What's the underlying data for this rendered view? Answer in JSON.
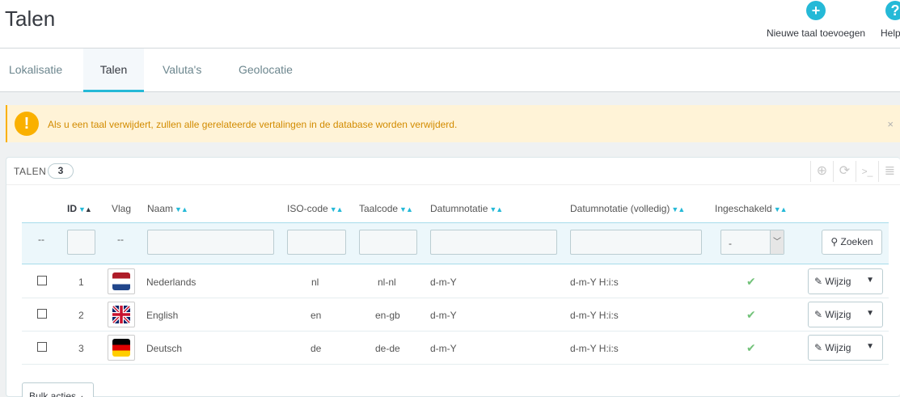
{
  "page": {
    "title": "Talen"
  },
  "toolbar": {
    "add": {
      "label": "Nieuwe taal toevoegen",
      "icon": "plus-circle-icon"
    },
    "help": {
      "label": "Help",
      "icon": "question-circle-icon"
    }
  },
  "tabs": [
    {
      "label": "Lokalisatie",
      "active": false
    },
    {
      "label": "Talen",
      "active": true
    },
    {
      "label": "Valuta's",
      "active": false
    },
    {
      "label": "Geolocatie",
      "active": false
    }
  ],
  "alert": {
    "text": "Als u een taal verwijdert, zullen alle gerelateerde vertalingen in de database worden verwijderd.",
    "close": "×",
    "icon": "exclamation-icon"
  },
  "panel": {
    "title": "TALEN",
    "count": "3",
    "tools": [
      "add-icon",
      "refresh-icon",
      "sql-terminal-icon",
      "database-icon"
    ]
  },
  "table": {
    "headers": {
      "id": "ID",
      "flag": "Vlag",
      "name": "Naam",
      "iso": "ISO-code",
      "lang": "Taalcode",
      "date": "Datumnotatie",
      "date_full": "Datumnotatie (volledig)",
      "active": "Ingeschakeld"
    },
    "filter": {
      "dash": "--",
      "select_value": "-",
      "search_label": "Zoeken"
    },
    "rows": [
      {
        "id": "1",
        "name": "Nederlands",
        "iso": "nl",
        "lang": "nl-nl",
        "date": "d-m-Y",
        "date_full": "d-m-Y H:i:s",
        "enabled": true
      },
      {
        "id": "2",
        "name": "English",
        "iso": "en",
        "lang": "en-gb",
        "date": "d-m-Y",
        "date_full": "d-m-Y H:i:s",
        "enabled": true
      },
      {
        "id": "3",
        "name": "Deutsch",
        "iso": "de",
        "lang": "de-de",
        "date": "d-m-Y",
        "date_full": "d-m-Y H:i:s",
        "enabled": true
      }
    ],
    "edit_label": "Wijzig",
    "bulk_label": "Bulk acties"
  },
  "colors": {
    "accent": "#25b9d7",
    "warning": "#fab000",
    "success": "#72c279"
  }
}
